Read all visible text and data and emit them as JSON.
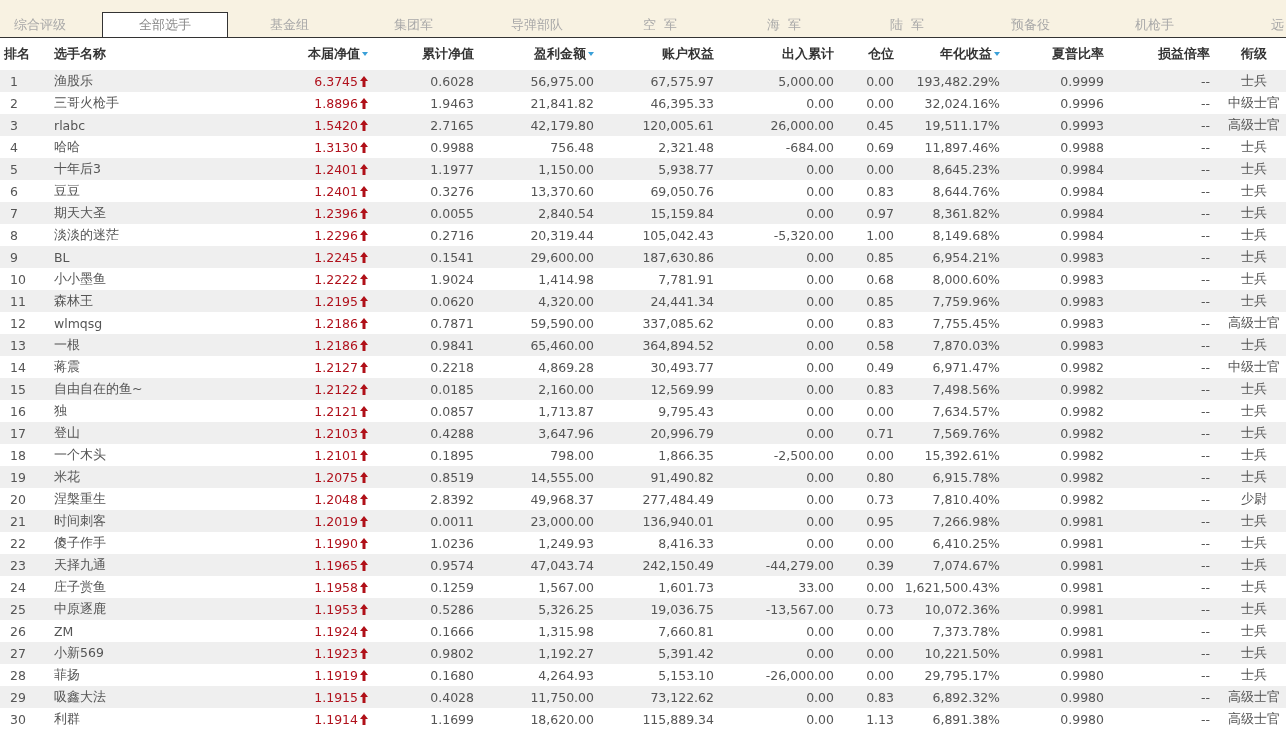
{
  "tabs": [
    {
      "label": "综合评级",
      "selected": false
    },
    {
      "label": "全部选手",
      "selected": true
    },
    {
      "label": "基金组",
      "selected": false
    },
    {
      "label": "集团军",
      "selected": false
    },
    {
      "label": "导弹部队",
      "selected": false
    },
    {
      "label": "空  军",
      "selected": false
    },
    {
      "label": "海  军",
      "selected": false
    },
    {
      "label": "陆  军",
      "selected": false
    },
    {
      "label": "预备役",
      "selected": false
    },
    {
      "label": "机枪手",
      "selected": false
    },
    {
      "label": "远",
      "selected": false
    }
  ],
  "table": {
    "columns": [
      {
        "label": "排名",
        "sortable": false
      },
      {
        "label": "选手名称",
        "sortable": false
      },
      {
        "label": "本届净值",
        "sortable": true
      },
      {
        "label": "累计净值",
        "sortable": false
      },
      {
        "label": "盈利金额",
        "sortable": true
      },
      {
        "label": "账户权益",
        "sortable": false
      },
      {
        "label": "出入累计",
        "sortable": false
      },
      {
        "label": "仓位",
        "sortable": false
      },
      {
        "label": "年化收益",
        "sortable": true
      },
      {
        "label": "夏普比率",
        "sortable": false
      },
      {
        "label": "损益倍率",
        "sortable": false
      },
      {
        "label": "衔级",
        "sortable": false
      }
    ],
    "rows": [
      {
        "up": true,
        "cells": [
          "1",
          "渔股乐",
          "6.3745",
          "0.6028",
          "56,975.00",
          "67,575.97",
          "5,000.00",
          "0.00",
          "193,482.29%",
          "0.9999",
          "--",
          "士兵"
        ]
      },
      {
        "up": true,
        "cells": [
          "2",
          "三哥火枪手",
          "1.8896",
          "1.9463",
          "21,841.82",
          "46,395.33",
          "0.00",
          "0.00",
          "32,024.16%",
          "0.9996",
          "--",
          "中级士官"
        ]
      },
      {
        "up": true,
        "cells": [
          "3",
          "rlabc",
          "1.5420",
          "2.7165",
          "42,179.80",
          "120,005.61",
          "26,000.00",
          "0.45",
          "19,511.17%",
          "0.9993",
          "--",
          "高级士官"
        ]
      },
      {
        "up": true,
        "cells": [
          "4",
          "哈哈",
          "1.3130",
          "0.9988",
          "756.48",
          "2,321.48",
          "-684.00",
          "0.69",
          "11,897.46%",
          "0.9988",
          "--",
          "士兵"
        ]
      },
      {
        "up": true,
        "cells": [
          "5",
          "十年后3",
          "1.2401",
          "1.1977",
          "1,150.00",
          "5,938.77",
          "0.00",
          "0.00",
          "8,645.23%",
          "0.9984",
          "--",
          "士兵"
        ]
      },
      {
        "up": true,
        "cells": [
          "6",
          "豆豆",
          "1.2401",
          "0.3276",
          "13,370.60",
          "69,050.76",
          "0.00",
          "0.83",
          "8,644.76%",
          "0.9984",
          "--",
          "士兵"
        ]
      },
      {
        "up": true,
        "cells": [
          "7",
          "期天大圣",
          "1.2396",
          "0.0055",
          "2,840.54",
          "15,159.84",
          "0.00",
          "0.97",
          "8,361.82%",
          "0.9984",
          "--",
          "士兵"
        ]
      },
      {
        "up": true,
        "cells": [
          "8",
          "淡淡的迷茫",
          "1.2296",
          "0.2716",
          "20,319.44",
          "105,042.43",
          "-5,320.00",
          "1.00",
          "8,149.68%",
          "0.9984",
          "--",
          "士兵"
        ]
      },
      {
        "up": true,
        "cells": [
          "9",
          "BL",
          "1.2245",
          "0.1541",
          "29,600.00",
          "187,630.86",
          "0.00",
          "0.85",
          "6,954.21%",
          "0.9983",
          "--",
          "士兵"
        ]
      },
      {
        "up": true,
        "cells": [
          "10",
          "小小墨鱼",
          "1.2222",
          "1.9024",
          "1,414.98",
          "7,781.91",
          "0.00",
          "0.68",
          "8,000.60%",
          "0.9983",
          "--",
          "士兵"
        ]
      },
      {
        "up": true,
        "cells": [
          "11",
          "森林王",
          "1.2195",
          "0.0620",
          "4,320.00",
          "24,441.34",
          "0.00",
          "0.85",
          "7,759.96%",
          "0.9983",
          "--",
          "士兵"
        ]
      },
      {
        "up": true,
        "cells": [
          "12",
          "wlmqsg",
          "1.2186",
          "0.7871",
          "59,590.00",
          "337,085.62",
          "0.00",
          "0.83",
          "7,755.45%",
          "0.9983",
          "--",
          "高级士官"
        ]
      },
      {
        "up": true,
        "cells": [
          "13",
          "一根",
          "1.2186",
          "0.9841",
          "65,460.00",
          "364,894.52",
          "0.00",
          "0.58",
          "7,870.03%",
          "0.9983",
          "--",
          "士兵"
        ]
      },
      {
        "up": true,
        "cells": [
          "14",
          "蒋震",
          "1.2127",
          "0.2218",
          "4,869.28",
          "30,493.77",
          "0.00",
          "0.49",
          "6,971.47%",
          "0.9982",
          "--",
          "中级士官"
        ]
      },
      {
        "up": true,
        "cells": [
          "15",
          "自由自在的鱼~",
          "1.2122",
          "0.0185",
          "2,160.00",
          "12,569.99",
          "0.00",
          "0.83",
          "7,498.56%",
          "0.9982",
          "--",
          "士兵"
        ]
      },
      {
        "up": true,
        "cells": [
          "16",
          "独",
          "1.2121",
          "0.0857",
          "1,713.87",
          "9,795.43",
          "0.00",
          "0.00",
          "7,634.57%",
          "0.9982",
          "--",
          "士兵"
        ]
      },
      {
        "up": true,
        "cells": [
          "17",
          "登山",
          "1.2103",
          "0.4288",
          "3,647.96",
          "20,996.79",
          "0.00",
          "0.71",
          "7,569.76%",
          "0.9982",
          "--",
          "士兵"
        ]
      },
      {
        "up": true,
        "cells": [
          "18",
          "一个木头",
          "1.2101",
          "0.1895",
          "798.00",
          "1,866.35",
          "-2,500.00",
          "0.00",
          "15,392.61%",
          "0.9982",
          "--",
          "士兵"
        ]
      },
      {
        "up": true,
        "cells": [
          "19",
          "米花",
          "1.2075",
          "0.8519",
          "14,555.00",
          "91,490.82",
          "0.00",
          "0.80",
          "6,915.78%",
          "0.9982",
          "--",
          "士兵"
        ]
      },
      {
        "up": true,
        "cells": [
          "20",
          "涅槃重生",
          "1.2048",
          "2.8392",
          "49,968.37",
          "277,484.49",
          "0.00",
          "0.73",
          "7,810.40%",
          "0.9982",
          "--",
          "少尉"
        ]
      },
      {
        "up": true,
        "cells": [
          "21",
          "时间刺客",
          "1.2019",
          "0.0011",
          "23,000.00",
          "136,940.01",
          "0.00",
          "0.95",
          "7,266.98%",
          "0.9981",
          "--",
          "士兵"
        ]
      },
      {
        "up": true,
        "cells": [
          "22",
          "傻子作手",
          "1.1990",
          "1.0236",
          "1,249.93",
          "8,416.33",
          "0.00",
          "0.00",
          "6,410.25%",
          "0.9981",
          "--",
          "士兵"
        ]
      },
      {
        "up": true,
        "cells": [
          "23",
          "天择九通",
          "1.1965",
          "0.9574",
          "47,043.74",
          "242,150.49",
          "-44,279.00",
          "0.39",
          "7,074.67%",
          "0.9981",
          "--",
          "士兵"
        ]
      },
      {
        "up": true,
        "cells": [
          "24",
          "庄子赏鱼",
          "1.1958",
          "0.1259",
          "1,567.00",
          "1,601.73",
          "33.00",
          "0.00",
          "1,621,500.43%",
          "0.9981",
          "--",
          "士兵"
        ]
      },
      {
        "up": true,
        "cells": [
          "25",
          "中原逐鹿",
          "1.1953",
          "0.5286",
          "5,326.25",
          "19,036.75",
          "-13,567.00",
          "0.73",
          "10,072.36%",
          "0.9981",
          "--",
          "士兵"
        ]
      },
      {
        "up": true,
        "cells": [
          "26",
          "ZM",
          "1.1924",
          "0.1666",
          "1,315.98",
          "7,660.81",
          "0.00",
          "0.00",
          "7,373.78%",
          "0.9981",
          "--",
          "士兵"
        ]
      },
      {
        "up": true,
        "cells": [
          "27",
          "小新569",
          "1.1923",
          "0.9802",
          "1,192.27",
          "5,391.42",
          "0.00",
          "0.00",
          "10,221.50%",
          "0.9981",
          "--",
          "士兵"
        ]
      },
      {
        "up": true,
        "cells": [
          "28",
          "菲扬",
          "1.1919",
          "0.1680",
          "4,264.93",
          "5,153.10",
          "-26,000.00",
          "0.00",
          "29,795.17%",
          "0.9980",
          "--",
          "士兵"
        ]
      },
      {
        "up": true,
        "cells": [
          "29",
          "吸鑫大法",
          "1.1915",
          "0.4028",
          "11,750.00",
          "73,122.62",
          "0.00",
          "0.83",
          "6,892.32%",
          "0.9980",
          "--",
          "高级士官"
        ]
      },
      {
        "up": true,
        "cells": [
          "30",
          "利群",
          "1.1914",
          "1.1699",
          "18,620.00",
          "115,889.34",
          "0.00",
          "1.13",
          "6,891.38%",
          "0.9980",
          "--",
          "高级士官"
        ]
      }
    ]
  }
}
